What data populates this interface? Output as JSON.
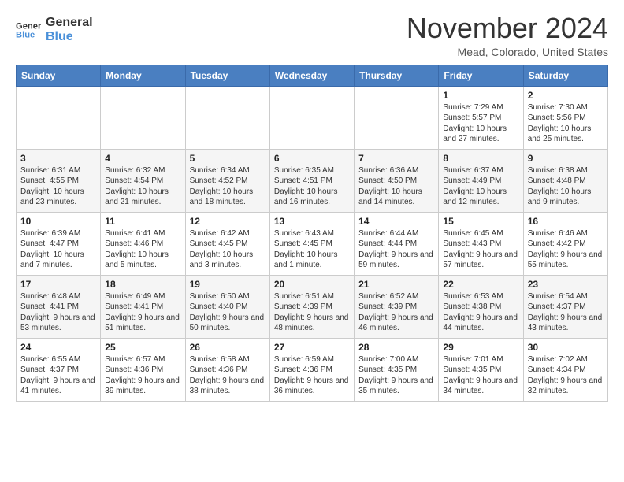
{
  "logo": {
    "line1": "General",
    "line2": "Blue"
  },
  "title": "November 2024",
  "subtitle": "Mead, Colorado, United States",
  "headers": [
    "Sunday",
    "Monday",
    "Tuesday",
    "Wednesday",
    "Thursday",
    "Friday",
    "Saturday"
  ],
  "weeks": [
    [
      {
        "day": "",
        "info": ""
      },
      {
        "day": "",
        "info": ""
      },
      {
        "day": "",
        "info": ""
      },
      {
        "day": "",
        "info": ""
      },
      {
        "day": "",
        "info": ""
      },
      {
        "day": "1",
        "info": "Sunrise: 7:29 AM\nSunset: 5:57 PM\nDaylight: 10 hours and 27 minutes."
      },
      {
        "day": "2",
        "info": "Sunrise: 7:30 AM\nSunset: 5:56 PM\nDaylight: 10 hours and 25 minutes."
      }
    ],
    [
      {
        "day": "3",
        "info": "Sunrise: 6:31 AM\nSunset: 4:55 PM\nDaylight: 10 hours and 23 minutes."
      },
      {
        "day": "4",
        "info": "Sunrise: 6:32 AM\nSunset: 4:54 PM\nDaylight: 10 hours and 21 minutes."
      },
      {
        "day": "5",
        "info": "Sunrise: 6:34 AM\nSunset: 4:52 PM\nDaylight: 10 hours and 18 minutes."
      },
      {
        "day": "6",
        "info": "Sunrise: 6:35 AM\nSunset: 4:51 PM\nDaylight: 10 hours and 16 minutes."
      },
      {
        "day": "7",
        "info": "Sunrise: 6:36 AM\nSunset: 4:50 PM\nDaylight: 10 hours and 14 minutes."
      },
      {
        "day": "8",
        "info": "Sunrise: 6:37 AM\nSunset: 4:49 PM\nDaylight: 10 hours and 12 minutes."
      },
      {
        "day": "9",
        "info": "Sunrise: 6:38 AM\nSunset: 4:48 PM\nDaylight: 10 hours and 9 minutes."
      }
    ],
    [
      {
        "day": "10",
        "info": "Sunrise: 6:39 AM\nSunset: 4:47 PM\nDaylight: 10 hours and 7 minutes."
      },
      {
        "day": "11",
        "info": "Sunrise: 6:41 AM\nSunset: 4:46 PM\nDaylight: 10 hours and 5 minutes."
      },
      {
        "day": "12",
        "info": "Sunrise: 6:42 AM\nSunset: 4:45 PM\nDaylight: 10 hours and 3 minutes."
      },
      {
        "day": "13",
        "info": "Sunrise: 6:43 AM\nSunset: 4:45 PM\nDaylight: 10 hours and 1 minute."
      },
      {
        "day": "14",
        "info": "Sunrise: 6:44 AM\nSunset: 4:44 PM\nDaylight: 9 hours and 59 minutes."
      },
      {
        "day": "15",
        "info": "Sunrise: 6:45 AM\nSunset: 4:43 PM\nDaylight: 9 hours and 57 minutes."
      },
      {
        "day": "16",
        "info": "Sunrise: 6:46 AM\nSunset: 4:42 PM\nDaylight: 9 hours and 55 minutes."
      }
    ],
    [
      {
        "day": "17",
        "info": "Sunrise: 6:48 AM\nSunset: 4:41 PM\nDaylight: 9 hours and 53 minutes."
      },
      {
        "day": "18",
        "info": "Sunrise: 6:49 AM\nSunset: 4:41 PM\nDaylight: 9 hours and 51 minutes."
      },
      {
        "day": "19",
        "info": "Sunrise: 6:50 AM\nSunset: 4:40 PM\nDaylight: 9 hours and 50 minutes."
      },
      {
        "day": "20",
        "info": "Sunrise: 6:51 AM\nSunset: 4:39 PM\nDaylight: 9 hours and 48 minutes."
      },
      {
        "day": "21",
        "info": "Sunrise: 6:52 AM\nSunset: 4:39 PM\nDaylight: 9 hours and 46 minutes."
      },
      {
        "day": "22",
        "info": "Sunrise: 6:53 AM\nSunset: 4:38 PM\nDaylight: 9 hours and 44 minutes."
      },
      {
        "day": "23",
        "info": "Sunrise: 6:54 AM\nSunset: 4:37 PM\nDaylight: 9 hours and 43 minutes."
      }
    ],
    [
      {
        "day": "24",
        "info": "Sunrise: 6:55 AM\nSunset: 4:37 PM\nDaylight: 9 hours and 41 minutes."
      },
      {
        "day": "25",
        "info": "Sunrise: 6:57 AM\nSunset: 4:36 PM\nDaylight: 9 hours and 39 minutes."
      },
      {
        "day": "26",
        "info": "Sunrise: 6:58 AM\nSunset: 4:36 PM\nDaylight: 9 hours and 38 minutes."
      },
      {
        "day": "27",
        "info": "Sunrise: 6:59 AM\nSunset: 4:36 PM\nDaylight: 9 hours and 36 minutes."
      },
      {
        "day": "28",
        "info": "Sunrise: 7:00 AM\nSunset: 4:35 PM\nDaylight: 9 hours and 35 minutes."
      },
      {
        "day": "29",
        "info": "Sunrise: 7:01 AM\nSunset: 4:35 PM\nDaylight: 9 hours and 34 minutes."
      },
      {
        "day": "30",
        "info": "Sunrise: 7:02 AM\nSunset: 4:34 PM\nDaylight: 9 hours and 32 minutes."
      }
    ]
  ]
}
